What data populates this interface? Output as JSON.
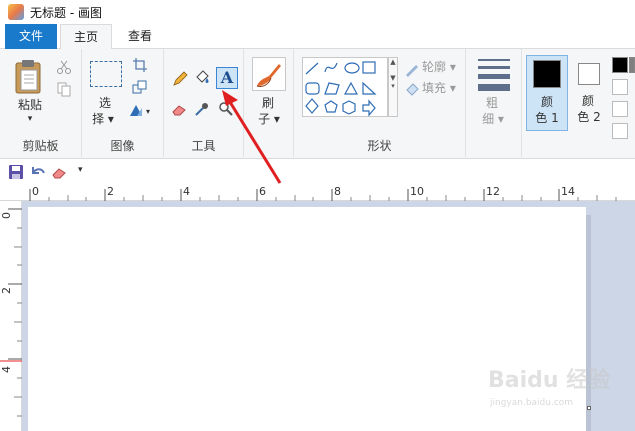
{
  "window": {
    "title": "无标题 - 画图"
  },
  "tabs": [
    {
      "label": "文件"
    },
    {
      "label": "主页"
    },
    {
      "label": "查看"
    }
  ],
  "ribbon": {
    "clipboard": {
      "paste_label": "粘贴",
      "group_label": "剪贴板"
    },
    "image": {
      "select_label_1": "选",
      "select_label_2": "择",
      "group_label": "图像"
    },
    "tools": {
      "group_label": "工具",
      "text_tool_glyph": "A"
    },
    "brushes": {
      "label_1": "刷",
      "label_2": "子"
    },
    "shapes": {
      "outline_label": "轮廓",
      "fill_label": "填充",
      "group_label": "形状"
    },
    "size": {
      "label_1": "粗",
      "label_2": "细"
    },
    "color1": {
      "label_1": "颜",
      "label_2": "色 1",
      "color": "#000000"
    },
    "color2": {
      "label_1": "颜",
      "label_2": "色 2",
      "color": "#ffffff"
    }
  },
  "ruler": {
    "h_numbers": [
      "0",
      "2",
      "4",
      "6",
      "8",
      "10",
      "12",
      "14"
    ],
    "v_numbers": [
      "0",
      "2",
      "4"
    ]
  },
  "watermark": {
    "text": "Baidu 经验",
    "sub": "jingyan.baidu.com"
  },
  "colors": {
    "accent": "#1979ca",
    "arrow": "#e02020",
    "workspace": "#ccd6e6"
  }
}
